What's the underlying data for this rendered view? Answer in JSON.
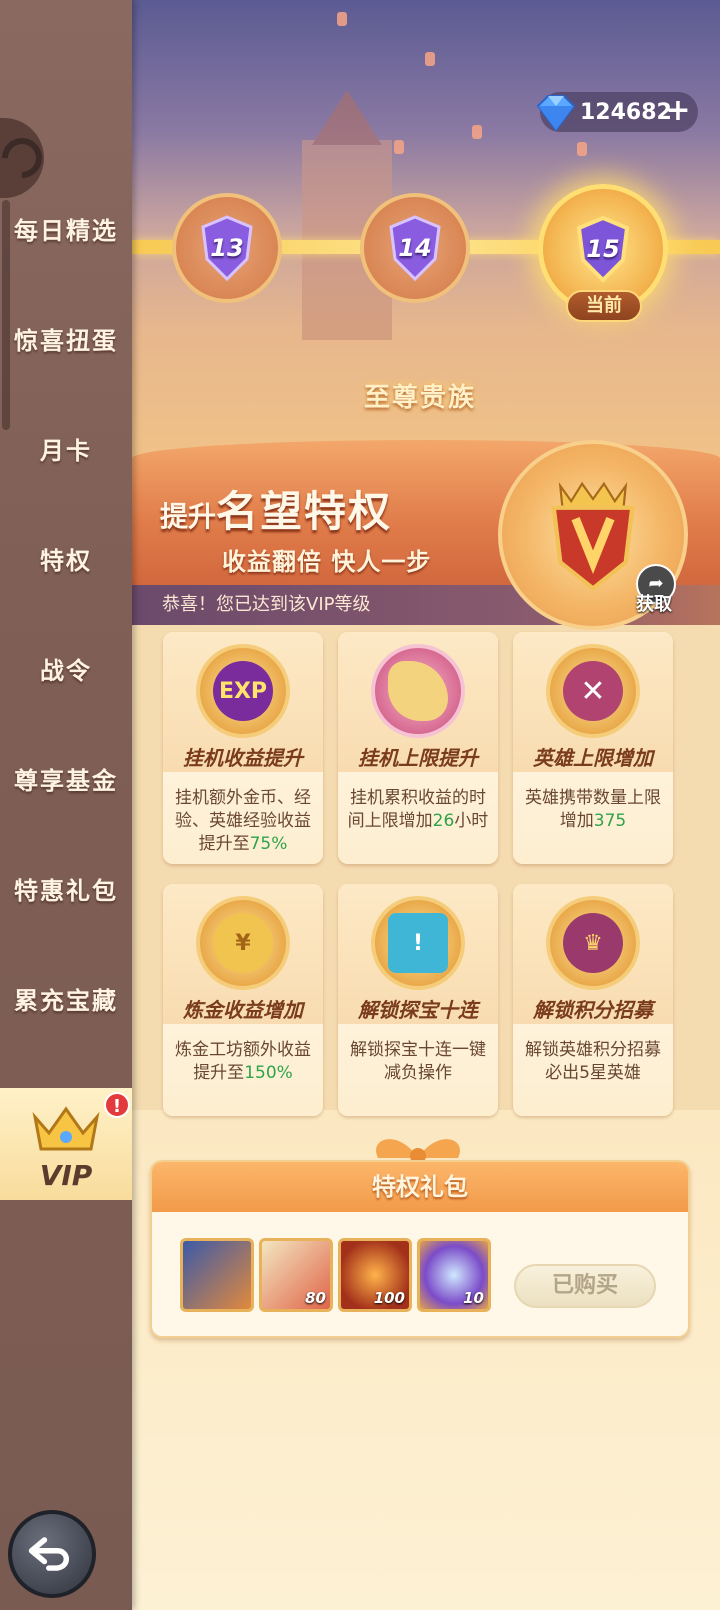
{
  "sidebar": {
    "items": [
      {
        "label": "每日精选"
      },
      {
        "label": "惊喜扭蛋"
      },
      {
        "label": "月卡"
      },
      {
        "label": "特权"
      },
      {
        "label": "战令"
      },
      {
        "label": "尊享基金"
      },
      {
        "label": "特惠礼包"
      },
      {
        "label": "累充宝藏"
      }
    ],
    "vip_label": "VIP",
    "vip_badge": "!"
  },
  "currency": {
    "gems": "124682",
    "icon": "diamond-icon"
  },
  "levels": {
    "items": [
      {
        "value": "13"
      },
      {
        "value": "14"
      },
      {
        "value": "15"
      }
    ],
    "current_tag": "当前"
  },
  "tier_name": "至尊贵族",
  "banner": {
    "title_small": "提升",
    "title_big": "名望特权",
    "subtitle": "收益翻倍  快人一步",
    "notice": "恭喜！您已达到该VIP等级",
    "fetch_label": "获取"
  },
  "cards": [
    {
      "title": "挂机收益提升",
      "desc_pre": "挂机额外金币、经验、英雄经验收益提升至",
      "desc_hl": "75%",
      "desc_post": "",
      "icon": "exp-icon"
    },
    {
      "title": "挂机上限提升",
      "desc_pre": "挂机累积收益的时间上限增加",
      "desc_hl": "26",
      "desc_post": "小时",
      "icon": "horn-icon"
    },
    {
      "title": "英雄上限增加",
      "desc_pre": "英雄携带数量上限增加",
      "desc_hl": "375",
      "desc_post": "",
      "icon": "crossed-swords-icon"
    },
    {
      "title": "炼金收益增加",
      "desc_pre": "炼金工坊额外收益提升至",
      "desc_hl": "150%",
      "desc_post": "",
      "icon": "gold-pot-icon"
    },
    {
      "title": "解锁探宝十连",
      "desc_pre": "解锁探宝十连一键减负操作",
      "desc_hl": "",
      "desc_post": "",
      "icon": "treasure-map-icon"
    },
    {
      "title": "解锁积分招募",
      "desc_pre": "解锁英雄积分招募必出5星英雄",
      "desc_hl": "",
      "desc_post": "",
      "icon": "crown-emblem-icon"
    }
  ],
  "gift": {
    "title": "特权礼包",
    "items": [
      {
        "count": "",
        "icon": "hero-card-icon"
      },
      {
        "count": "80",
        "icon": "hourglass-chest-icon"
      },
      {
        "count": "100",
        "icon": "fire-demon-icon"
      },
      {
        "count": "10",
        "icon": "crystal-icon"
      }
    ],
    "button": "已购买"
  },
  "colors": {
    "accent": "#e07c4a",
    "highlight": "#2fa34a",
    "sidebar": "#7f5f55"
  }
}
